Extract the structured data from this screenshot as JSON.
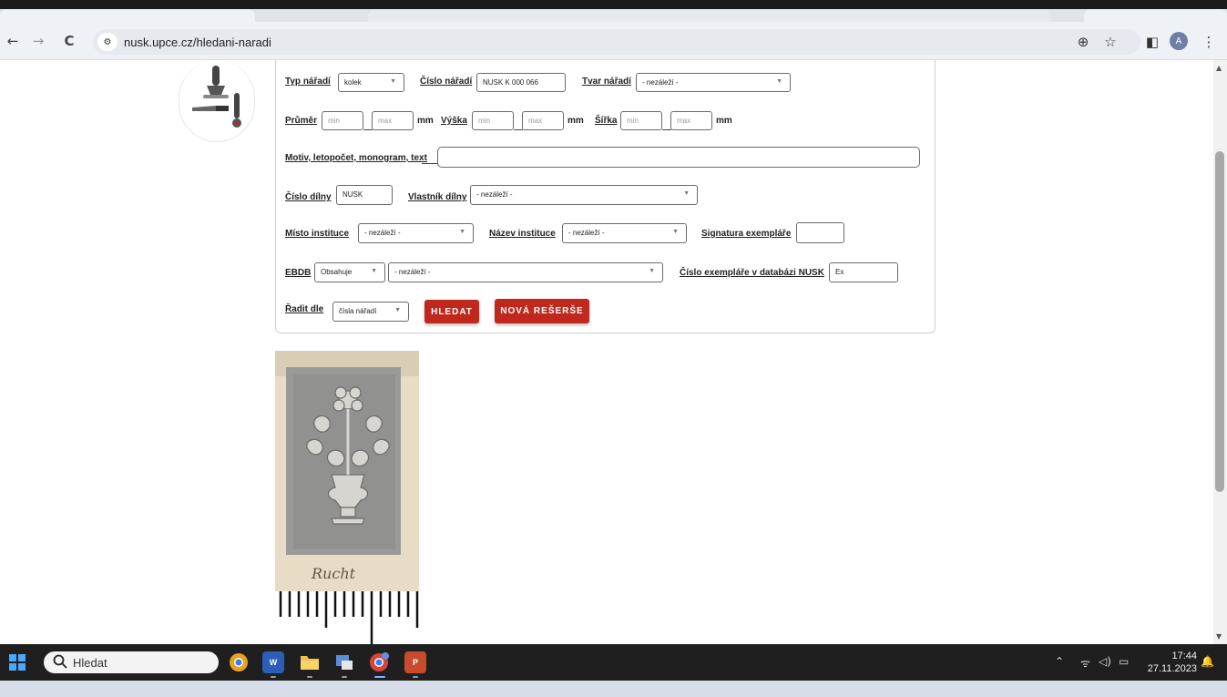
{
  "browser": {
    "url": "nusk.upce.cz/hledani-naradi",
    "nav": {
      "back": "←",
      "forward": "→",
      "reload": "C"
    },
    "site_icon": "⚙",
    "toolbar_icons": {
      "zoom": "⊕",
      "bookmark": "☆",
      "sidepanel": "◧",
      "menu": "⋮"
    },
    "profile_initial": "A"
  },
  "search_form": {
    "typ_naradi": {
      "label": "Typ nářadí",
      "value": "kolek"
    },
    "cislo_naradi": {
      "label": "Číslo nářadí",
      "value": "NUSK K 000 066"
    },
    "tvar_naradi": {
      "label": "Tvar nářadí",
      "value": "- nezáleží -"
    },
    "prumer": {
      "label": "Průměr",
      "min": "min",
      "max": "max",
      "unit": "mm"
    },
    "vyska": {
      "label": "Výška",
      "min": "min",
      "max": "max",
      "unit": "mm"
    },
    "sirka": {
      "label": "Šířka",
      "min": "min",
      "max": "max",
      "unit": "mm"
    },
    "motiv": {
      "label": "Motiv, letopočet, monogram, text",
      "value": ""
    },
    "cislo_dilny": {
      "label": "Číslo dílny",
      "value": "NUSK"
    },
    "vlastnik_dilny": {
      "label": "Vlastník dílny",
      "value": "- nezáleží -"
    },
    "misto_instituce": {
      "label": "Místo instituce",
      "value": "- nezáleží -"
    },
    "nazev_instituce": {
      "label": "Název instituce",
      "value": "- nezáleží -"
    },
    "signatura": {
      "label": "Signatura exempláře",
      "value": ""
    },
    "ebdb": {
      "label": "EBDB",
      "mode": "Obsahuje",
      "value": "- nezáleží -"
    },
    "cislo_exemplare": {
      "label": "Číslo exempláře v databázi NUSK",
      "value": "Ex"
    },
    "radit_dle": {
      "label": "Řadit dle",
      "value": "čísla nářadí"
    },
    "buttons": {
      "search": "HLEDAT",
      "new": "NOVÁ REŠERŠE"
    }
  },
  "specimen": {
    "handwriting": "Rucht"
  },
  "taskbar": {
    "search_label": "Hledat",
    "apps": [
      "chrome",
      "word",
      "file-explorer",
      "app-generic",
      "chrome-profile",
      "powerpoint"
    ],
    "time": "17:44",
    "date": "27.11.2023"
  },
  "colors": {
    "accent_red": "#c0281e",
    "taskbar": "#1f1f1f",
    "toolbar": "#eef1f6"
  }
}
